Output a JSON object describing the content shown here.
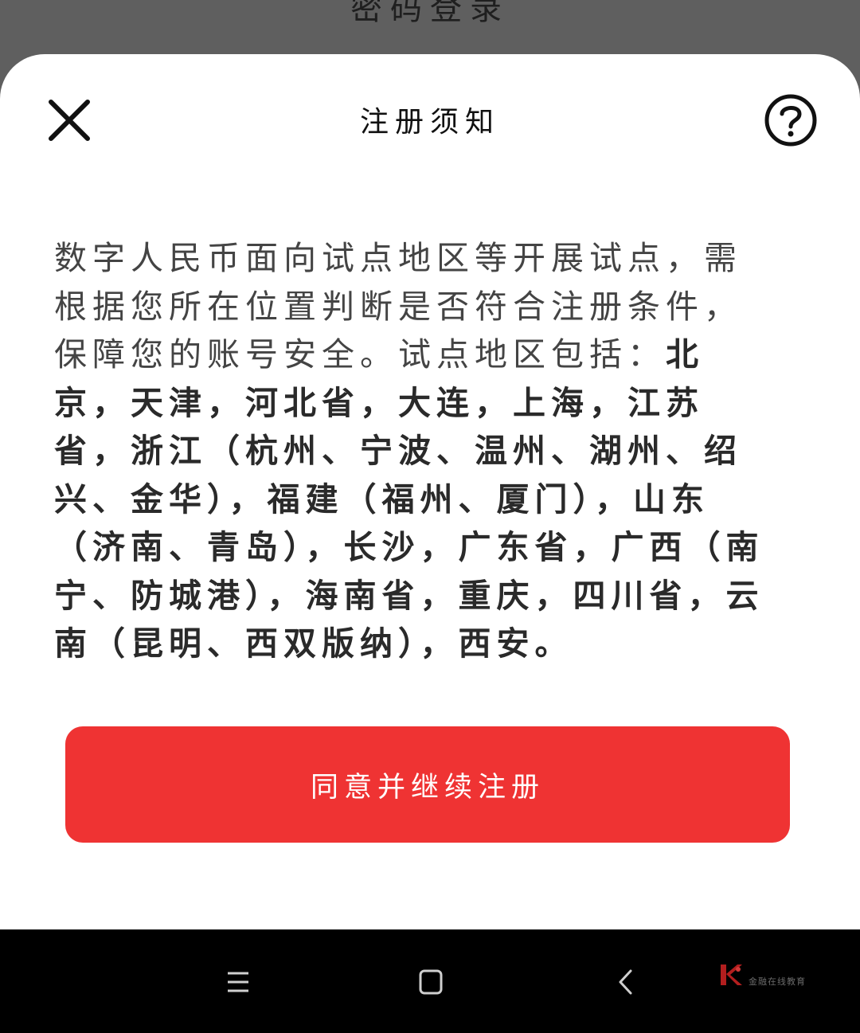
{
  "background_screen": {
    "title_partial": "密码登录"
  },
  "dialog": {
    "title": "注册须知",
    "close_icon": "close-icon",
    "help_icon": "question-icon",
    "notice_intro": "数字人民币面向试点地区等开展试点，需根据您所在位置判断是否符合注册条件，保障您的账号安全。试点地区包括：",
    "notice_regions": "北京，天津，河北省，大连，上海，江苏省，浙江（杭州、宁波、温州、湖州、绍兴、金华），福建（福州、厦门），山东（济南、青岛），长沙，广东省，广西（南宁、防城港），海南省，重庆，四川省，云南（昆明、西双版纳），西安。",
    "agree_button_label": "同意并继续注册",
    "accent_color": "#ef3333"
  },
  "nav_bar": {
    "menu_icon": "menu-icon",
    "home_icon": "home-square-icon",
    "back_icon": "back-chevron-icon"
  },
  "watermark": {
    "text": "金融在线教育"
  }
}
